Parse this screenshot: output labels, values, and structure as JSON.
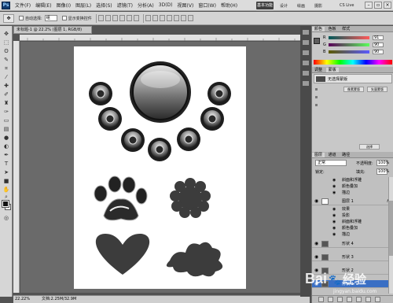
{
  "menu": {
    "logo": "Ps",
    "items": [
      "文件(F)",
      "编辑(E)",
      "图像(I)",
      "图层(L)",
      "选择(S)",
      "滤镜(T)",
      "分析(A)",
      "3D(D)",
      "视图(V)",
      "窗口(W)",
      "帮助(H)"
    ],
    "zoom": "22.2",
    "workspace_active": "基本功能",
    "workspace_items": [
      "设计",
      "绘画",
      "摄影"
    ],
    "cs_live": "CS Live"
  },
  "options": {
    "auto_select_label": "自动选择:",
    "auto_select_value": "组",
    "transform_label": "显示变换控件"
  },
  "document": {
    "tab_title": "未标题-1 @ 22.2% (图层 1, RGB/8)",
    "zoom_level": "22.22%",
    "doc_info": "文档:2.25M/32.9M"
  },
  "color_panel": {
    "tabs": [
      "颜色",
      "色板",
      "样式"
    ],
    "channels": [
      {
        "label": "R",
        "value": "91"
      },
      {
        "label": "G",
        "value": "90"
      },
      {
        "label": "B",
        "value": "90"
      }
    ],
    "fg_color": "#5d5d5d"
  },
  "adjust_panel": {
    "tabs": [
      "调整",
      "蒙版"
    ],
    "header_label": "无选择蒙版",
    "buttons": [
      "像素蒙版",
      "矢量蒙版",
      "选择",
      "颜色范围",
      "反相"
    ]
  },
  "layers_panel": {
    "tabs": [
      "图层",
      "通道",
      "路径"
    ],
    "blend_mode": "正常",
    "opacity_label": "不透明度:",
    "opacity_value": "100%",
    "lock_label": "锁定:",
    "fill_label": "填充:",
    "fill_value": "100%",
    "rows": [
      {
        "type": "effect",
        "name": "斜面和浮雕"
      },
      {
        "type": "effect",
        "name": "颜色叠加"
      },
      {
        "type": "effect",
        "name": "描边"
      },
      {
        "type": "layer",
        "name": "图层 1",
        "fx": true,
        "selected": false
      },
      {
        "type": "effect",
        "name": "效果"
      },
      {
        "type": "effect",
        "name": "投影"
      },
      {
        "type": "effect",
        "name": "斜面和浮雕"
      },
      {
        "type": "effect",
        "name": "颜色叠加"
      },
      {
        "type": "effect",
        "name": "描边"
      },
      {
        "type": "layer",
        "name": "形状 4",
        "fx": false,
        "selected": false
      },
      {
        "type": "layer",
        "name": "形状 3",
        "fx": false,
        "selected": false
      },
      {
        "type": "layer",
        "name": "形状 2",
        "fx": false,
        "selected": false
      },
      {
        "type": "layer",
        "name": "形状 1",
        "fx": false,
        "selected": true
      }
    ]
  },
  "watermark": {
    "brand": "Bai",
    "brand_tail": "经验",
    "url": "jingyan.baidu.com"
  }
}
